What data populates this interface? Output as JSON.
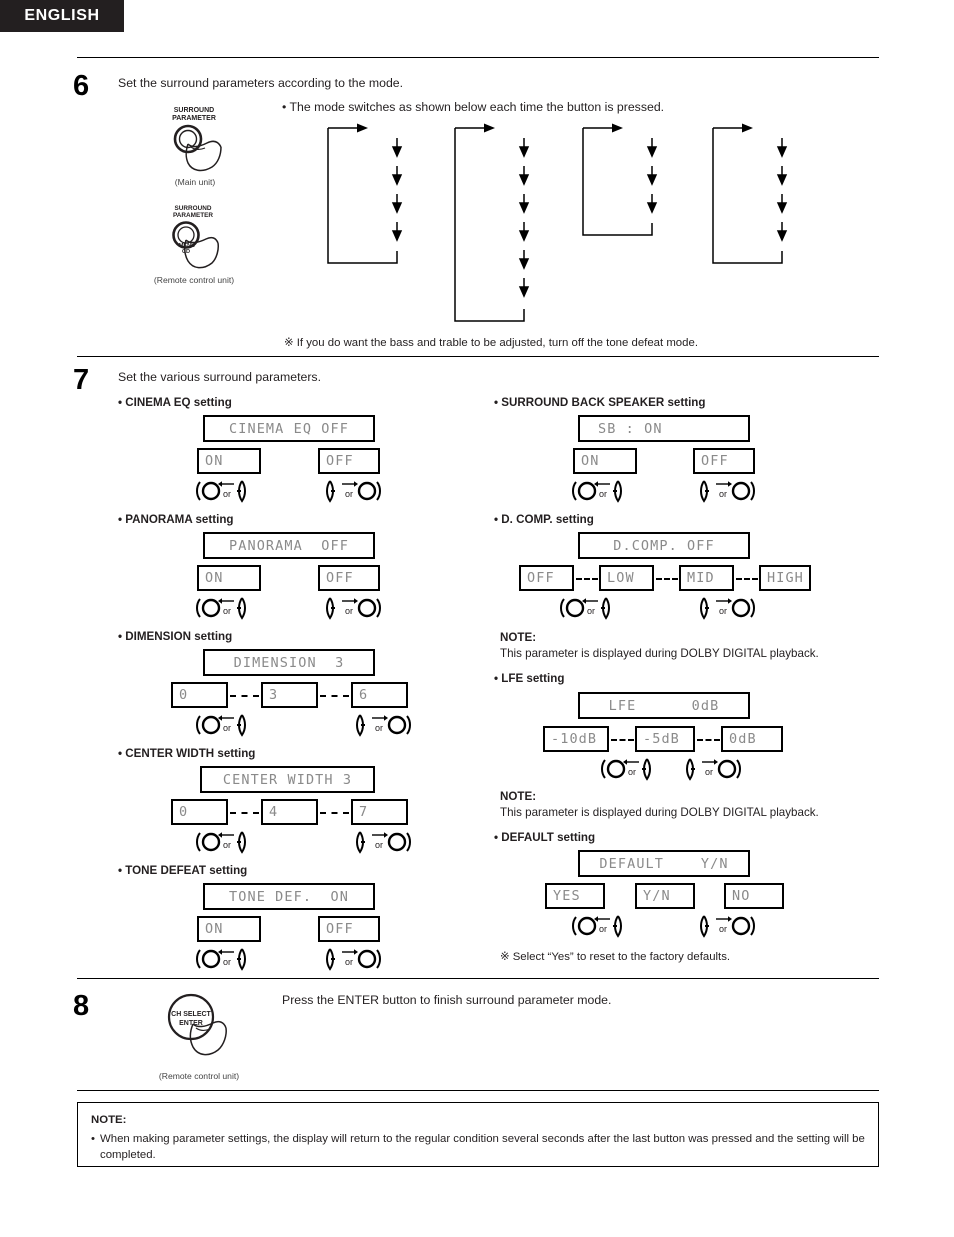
{
  "header": {
    "language_tab": "ENGLISH"
  },
  "step6": {
    "number": "6",
    "instruction": "Set the surround parameters according to the mode.",
    "bullet": "• The mode switches as shown below each time the button is pressed.",
    "button_main": {
      "label_line1": "SURROUND",
      "label_line2": "PARAMETER",
      "caption": "(Main unit)"
    },
    "button_remote": {
      "label_line1": "SURROUND",
      "label_line2": "PARAMETER",
      "caption": "(Remote control unit)"
    },
    "footnote": "※ If you do want the bass and trable to be adjusted, turn off the tone defeat mode.",
    "flow_columns": [
      {
        "arrow_count": 4
      },
      {
        "arrow_count": 6
      },
      {
        "arrow_count": 3
      },
      {
        "arrow_count": 4
      }
    ]
  },
  "step7": {
    "number": "7",
    "instruction": "Set the various surround parameters.",
    "left_sections": [
      {
        "title": "• CINEMA EQ setting",
        "display": "CINEMA EQ OFF",
        "options": [
          "ON",
          "OFF"
        ],
        "separator": "none",
        "op_left": "or",
        "op_right": "or"
      },
      {
        "title": "• PANORAMA setting",
        "display": "PANORAMA  OFF",
        "options": [
          "ON",
          "OFF"
        ],
        "separator": "none",
        "op_left": "or",
        "op_right": "or"
      },
      {
        "title": "• DIMENSION setting",
        "display": "DIMENSION  3",
        "options": [
          "0",
          "3",
          "6"
        ],
        "separator": "dashes",
        "op_left": "or",
        "op_right": "or"
      },
      {
        "title": "• CENTER WIDTH setting",
        "display": "CENTER WIDTH 3",
        "options": [
          "0",
          "4",
          "7"
        ],
        "separator": "dashes",
        "op_left": "or",
        "op_right": "or"
      },
      {
        "title": "• TONE DEFEAT setting",
        "display": "TONE DEF.  ON",
        "options": [
          "ON",
          "OFF"
        ],
        "separator": "none",
        "op_left": "or",
        "op_right": "or"
      }
    ],
    "right_sections": [
      {
        "title": "• SURROUND BACK SPEAKER setting",
        "display": "SB : ON",
        "options": [
          "ON",
          "OFF"
        ],
        "separator": "none",
        "op_left": "or",
        "op_right": "or"
      },
      {
        "title": "• D. COMP. setting",
        "display": "D.COMP. OFF",
        "options": [
          "OFF",
          "LOW",
          "MID",
          "HIGH"
        ],
        "separator": "dashes",
        "op_left": "or",
        "op_right": "or",
        "note_title": "NOTE:",
        "note_body": "This parameter is displayed during DOLBY DIGITAL playback."
      },
      {
        "title": "• LFE setting",
        "display": "LFE      0dB",
        "options": [
          "-10dB",
          "-5dB",
          "0dB"
        ],
        "separator": "dashes",
        "op_left": "or",
        "op_right": "or",
        "note_title": "NOTE:",
        "note_body": "This parameter is displayed during DOLBY DIGITAL playback."
      },
      {
        "title": "• DEFAULT setting",
        "display": "DEFAULT    Y/N",
        "options": [
          "YES",
          "Y/N",
          "NO"
        ],
        "separator": "none",
        "op_left": "or",
        "op_right": "or",
        "footnote": "※ Select “Yes” to reset to the factory defaults."
      }
    ]
  },
  "step8": {
    "number": "8",
    "instruction": "Press the ENTER button to finish surround parameter mode.",
    "button": {
      "label_line1": "CH SELECT",
      "label_line2": "ENTER",
      "caption": "(Remote control unit)"
    }
  },
  "bottom_note": {
    "title": "NOTE:",
    "bullet_marker": "•",
    "body": "When making parameter settings, the display will return to the regular condition several seconds after the last button was pressed and the setting will be completed."
  },
  "colors": {
    "ink": "#231f20",
    "lcd_text": "#8a8a8a",
    "tab_bg": "#231f20"
  }
}
